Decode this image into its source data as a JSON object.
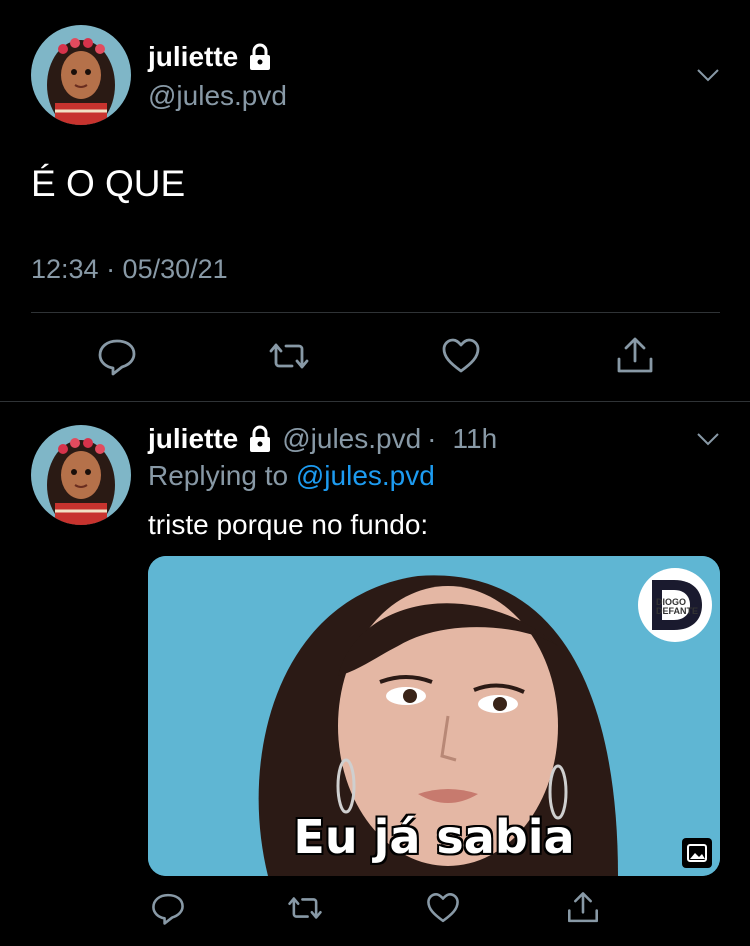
{
  "tweet": {
    "display_name": "juliette",
    "handle": "@jules.pvd",
    "text": "É O QUE",
    "timestamp": "12:34 · 05/30/21",
    "actions": [
      "reply-icon",
      "retweet-icon",
      "like-icon",
      "share-icon"
    ]
  },
  "reply": {
    "display_name": "juliette",
    "handle": "@jules.pvd",
    "separator": "·",
    "age": "11h",
    "replying_prefix": "Replying to",
    "replying_to": "@jules.pvd",
    "text": "triste porque no fundo:",
    "media_caption": "Eu já sabia",
    "media_logo_text": "DIOGO DEFANTE",
    "actions": [
      "reply-icon",
      "retweet-icon",
      "like-icon",
      "share-icon"
    ]
  },
  "colors": {
    "background": "#000000",
    "secondary_text": "#8899a6",
    "link": "#1d9bf0",
    "divider": "#2f3336"
  }
}
